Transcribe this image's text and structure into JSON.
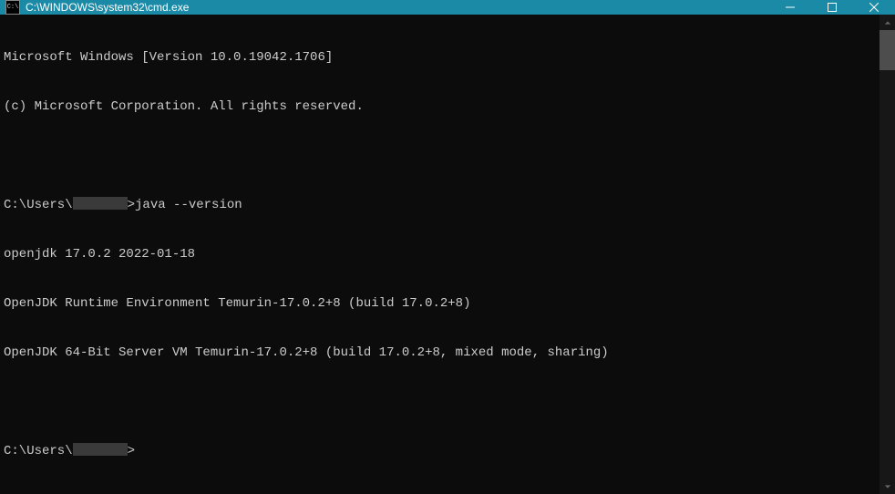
{
  "titlebar": {
    "icon_text": "C:\\",
    "title": "C:\\WINDOWS\\system32\\cmd.exe"
  },
  "terminal": {
    "banner1": "Microsoft Windows [Version 10.0.19042.1706]",
    "banner2": "(c) Microsoft Corporation. All rights reserved.",
    "prompt1_prefix": "C:\\Users\\",
    "prompt1_sep": ">",
    "command1": "java --version",
    "output1": "openjdk 17.0.2 2022-01-18",
    "output2": "OpenJDK Runtime Environment Temurin-17.0.2+8 (build 17.0.2+8)",
    "output3": "OpenJDK 64-Bit Server VM Temurin-17.0.2+8 (build 17.0.2+8, mixed mode, sharing)",
    "prompt2_prefix": "C:\\Users\\",
    "prompt2_sep": ">"
  }
}
